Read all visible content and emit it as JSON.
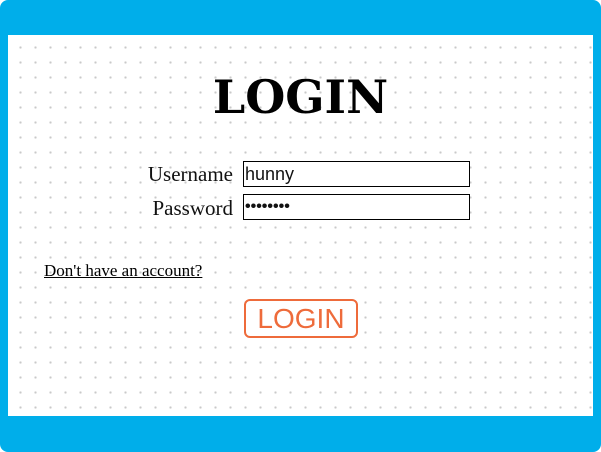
{
  "page": {
    "title": "LOGIN"
  },
  "form": {
    "username_label": "Username",
    "username_value": "hunny",
    "password_label": "Password",
    "password_value": "••••••••"
  },
  "links": {
    "signup": "Don't have an account?"
  },
  "actions": {
    "login_label": "LOGIN"
  },
  "colors": {
    "frame": "#00aeea",
    "button_accent": "#ee6b3b",
    "panel_background": "#ffffff",
    "dot_pattern": "#c9c9c9"
  }
}
